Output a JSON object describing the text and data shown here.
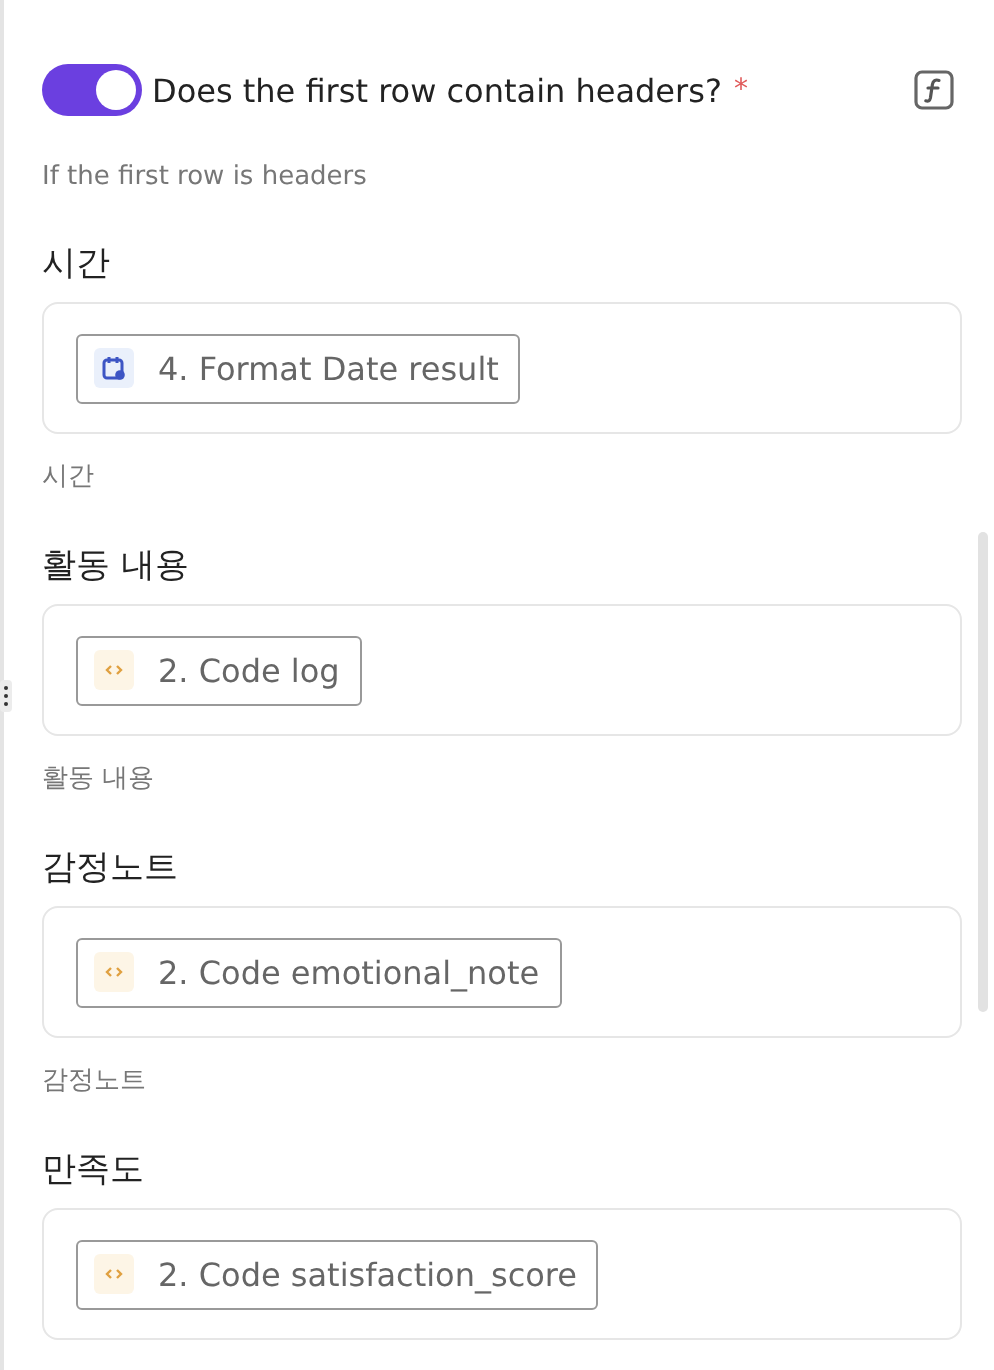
{
  "header_toggle": {
    "on": true,
    "label": "Does the first row contain headers?",
    "required_mark": "*",
    "hint": "If the first row is headers"
  },
  "fields": [
    {
      "label": "시간",
      "token": {
        "kind": "date",
        "text": "4. Format Date result"
      },
      "hint": "시간"
    },
    {
      "label": "활동 내용",
      "token": {
        "kind": "code",
        "text": "2. Code log"
      },
      "hint": "활동 내용"
    },
    {
      "label": "감정노트",
      "token": {
        "kind": "code",
        "text": "2. Code emotional_note"
      },
      "hint": "감정노트"
    },
    {
      "label": "만족도",
      "token": {
        "kind": "code",
        "text": "2. Code satisfaction_score"
      }
    }
  ]
}
